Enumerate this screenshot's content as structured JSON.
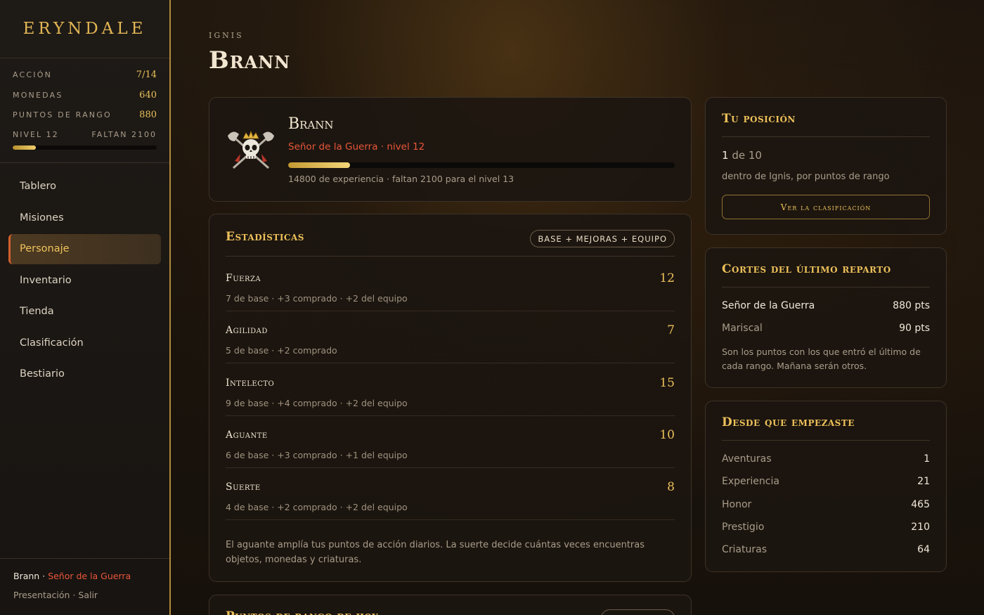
{
  "sidebar": {
    "brand": "ERYNDALE",
    "stats": [
      {
        "label": "ACCIÓN",
        "value": "7/14"
      },
      {
        "label": "MONEDAS",
        "value": "640"
      },
      {
        "label": "PUNTOS DE RANGO",
        "value": "880"
      }
    ],
    "level": {
      "label": "NIVEL 12",
      "remaining": "FALTAN 2100",
      "progress": 0.16
    },
    "nav": [
      "Tablero",
      "Misiones",
      "Personaje",
      "Inventario",
      "Tienda",
      "Clasificación",
      "Bestiario"
    ],
    "active_nav": "Personaje",
    "footer": {
      "name": "Brann",
      "sep": " · ",
      "rank": "Señor de la Guerra",
      "links": "Presentación · Salir"
    }
  },
  "page": {
    "kicker": "IGNIS",
    "title": "Brann"
  },
  "hero": {
    "name": "Brann",
    "rank_line": "Señor de la Guerra · nivel 12",
    "xp_progress": 0.16,
    "xp_text": "14800 de experiencia · faltan 2100 para el nivel 13",
    "icon": "crowned-skull-crossed-axes-icon"
  },
  "stats_card": {
    "title": "Estadísticas",
    "badge": "BASE + MEJORAS + EQUIPO",
    "attributes": [
      {
        "name": "Fuerza",
        "value": "12",
        "detail": "7 de base · +3 comprado · +2 del equipo"
      },
      {
        "name": "Agilidad",
        "value": "7",
        "detail": "5 de base · +2 comprado"
      },
      {
        "name": "Intelecto",
        "value": "15",
        "detail": "9 de base · +4 comprado · +2 del equipo"
      },
      {
        "name": "Aguante",
        "value": "10",
        "detail": "6 de base · +3 comprado · +1 del equipo"
      },
      {
        "name": "Suerte",
        "value": "8",
        "detail": "4 de base · +2 comprado · +2 del equipo"
      }
    ],
    "note": "El aguante amplía tus puntos de acción diarios. La suerte decide cuántas veces encuentras objetos, monedas y criaturas."
  },
  "rank_today": {
    "title": "Puntos de rango de hoy"
  },
  "position": {
    "title": "Tu posición",
    "rank": "1",
    "of": " de 10",
    "sub": "dentro de Ignis, por puntos de rango",
    "button": "Ver la clasificación"
  },
  "cuts": {
    "title": "Cortes del último reparto",
    "rows": [
      {
        "label": "Señor de la Guerra",
        "value": "880 pts"
      },
      {
        "label": "Mariscal",
        "value": "90 pts"
      }
    ],
    "note": "Son los puntos con los que entró el último de cada rango. Mañana serán otros."
  },
  "since": {
    "title": "Desde que empezaste",
    "rows": [
      {
        "label": "Aventuras",
        "value": "1"
      },
      {
        "label": "Experiencia",
        "value": "21"
      },
      {
        "label": "Honor",
        "value": "465"
      },
      {
        "label": "Prestigio",
        "value": "210"
      },
      {
        "label": "Criaturas",
        "value": "64"
      }
    ]
  },
  "colors": {
    "accent_gold": "#ecc05a",
    "accent_red": "#e8563a",
    "border": "#3d3327"
  }
}
